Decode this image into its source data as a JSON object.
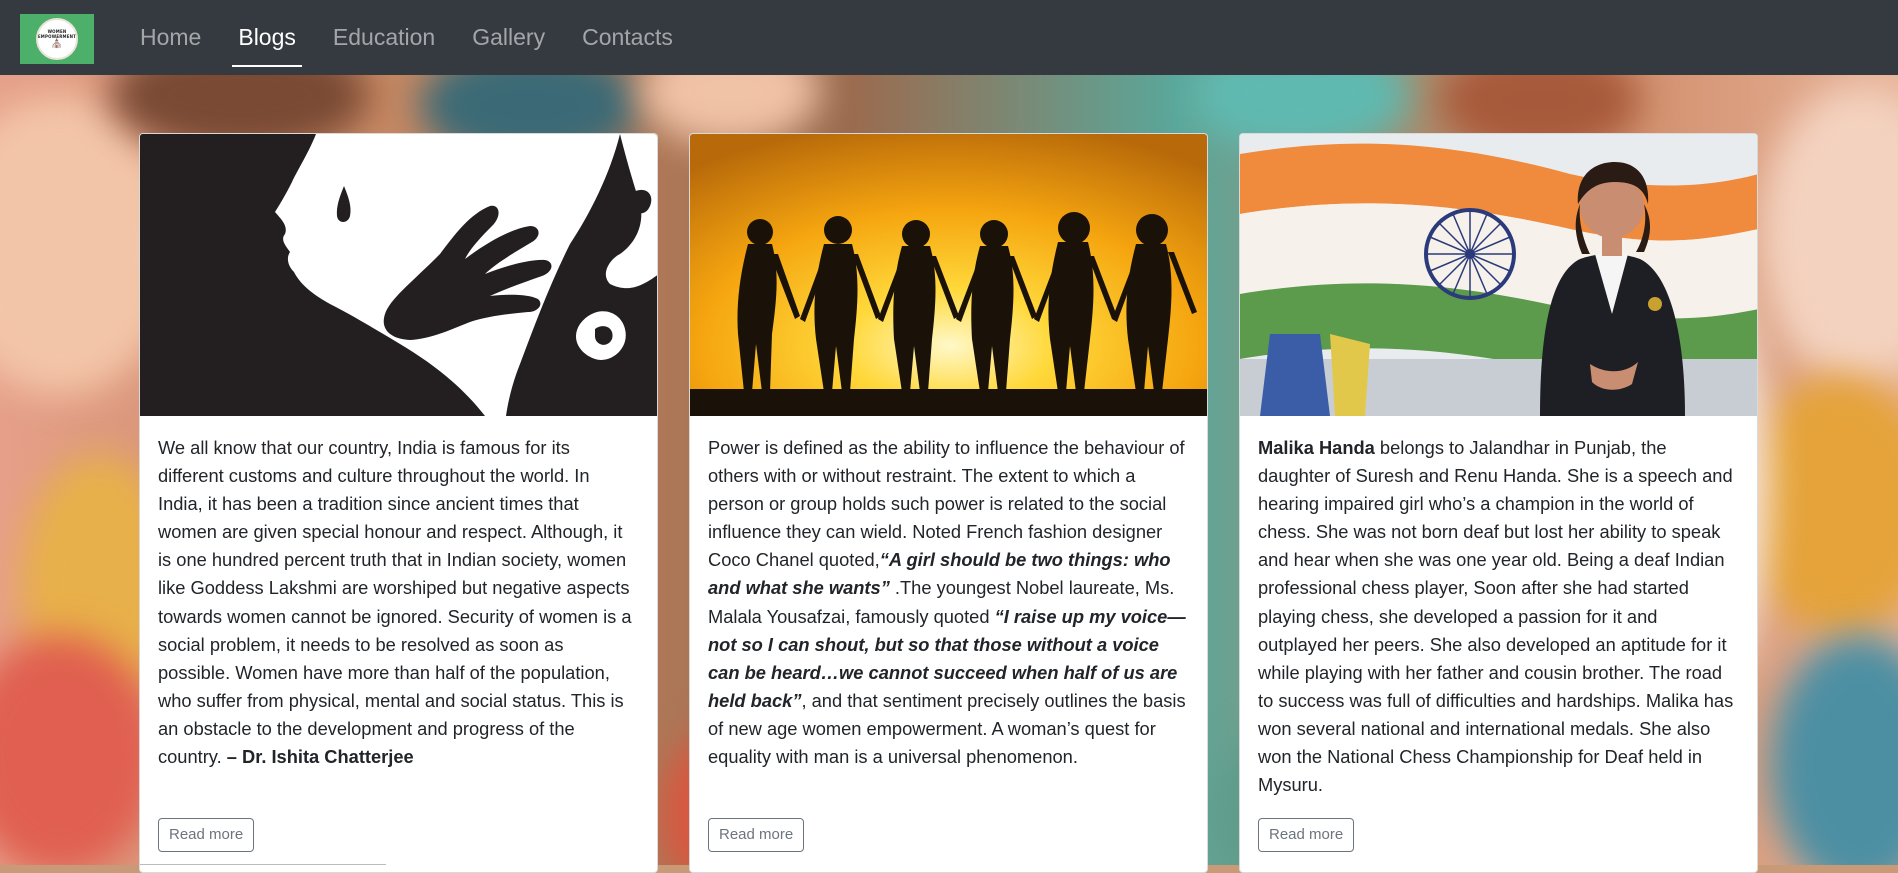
{
  "nav": {
    "brand_text": "WOMEN EMPOWERMENT",
    "links": [
      "Home",
      "Blogs",
      "Education",
      "Gallery",
      "Contacts"
    ],
    "active": "Blogs"
  },
  "cards": [
    {
      "image": "woman-silhouette-hand-illustration",
      "paragraph_parts": [
        "We all know that our country, India is famous for its different customs and culture throughout the world. In India, it has been a tradition since ancient times that women are given special honour and respect. Although, it is one hundred percent truth that in Indian society, women like Goddess Lakshmi are worshiped but negative aspects towards women cannot be ignored. Security of women is a social problem, it needs to be resolved as soon as possible. Women have more than half of the population, who suffer from physical, mental and social status. This is an obstacle to the development and progress of the country. ",
        "– Dr. Ishita Chatterjee"
      ],
      "button": "Read more"
    },
    {
      "image": "women-holding-hands-sunset-silhouette",
      "paragraph_parts": [
        "Power is defined as the ability to influence the behaviour of others with or without restraint. The extent to which a person or group holds such power is related to the social influence they can wield. Noted French fashion designer Coco Chanel quoted,",
        "“A girl should be two things: who and what she wants”",
        " .The youngest Nobel laureate, Ms. Malala Yousafzai, famously quoted ",
        "“I raise up my voice—not so I can shout, but so that those without a voice can be heard…we cannot succeed when half of us are held back”",
        ", and that sentiment precisely outlines the basis of new age women empowerment. A woman’s quest for equality with man is a universal phenomenon."
      ],
      "button": "Read more"
    },
    {
      "image": "woman-with-indian-flag-photo",
      "paragraph_parts": [
        "Malika Handa",
        " belongs to Jalandhar in Punjab, the daughter of Suresh and Renu Handa. She is a speech and hearing impaired girl who’s a champion in the world of chess. She was not born deaf but lost her ability to speak and hear when she was one year old. Being a deaf Indian professional chess player, Soon after she had started playing chess, she developed a passion for it and outplayed her peers. She also developed an aptitude for it while playing with her father and cousin brother. The road to success was full of difficulties and hardships. Malika has won several national and international medals. She also won the National Chess Championship for Deaf held in Mysuru."
      ],
      "button": "Read more"
    }
  ],
  "colors": {
    "navbar": "#343a40",
    "brand_bg": "#4caf6a",
    "nav_inactive": "rgba(255,255,255,0.55)",
    "nav_active": "#ffffff",
    "button_outline": "#6c757d"
  }
}
